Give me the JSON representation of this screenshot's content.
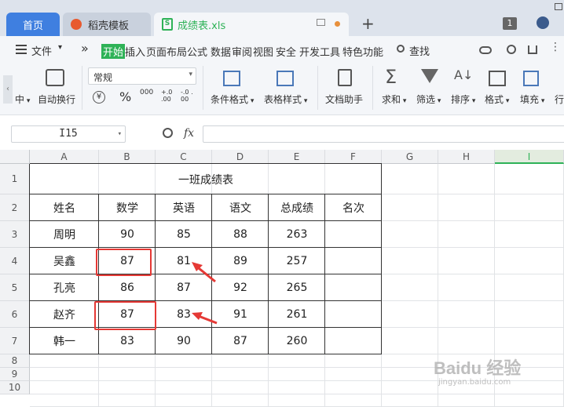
{
  "tabs": {
    "home": "首页",
    "template": "稻壳模板",
    "file": "成绩表.xls",
    "add": "+"
  },
  "titlebar": {
    "badge": "1"
  },
  "menu": {
    "file": "文件",
    "more": "»",
    "items": [
      "开始",
      "插入",
      "页面布局",
      "公式",
      "数据",
      "审阅",
      "视图",
      "安全",
      "开发工具",
      "特色功能"
    ],
    "search": "查找"
  },
  "ribbon": {
    "center": "中",
    "wrap": "自动换行",
    "format_value": "常规",
    "currency": "¥",
    "percent": "%",
    "thousands": "000",
    "inc_decimal": "+.0 .00",
    "dec_decimal": "-.0 .00",
    "cond_format": "条件格式",
    "table_style": "表格样式",
    "doc_helper": "文档助手",
    "sum": "求和",
    "filter": "筛选",
    "sort": "排序",
    "format": "格式",
    "fill": "填充",
    "row": "行"
  },
  "formula": {
    "namebox": "I15",
    "fx": "fx"
  },
  "columns": [
    "A",
    "B",
    "C",
    "D",
    "E",
    "F",
    "G",
    "H",
    "I"
  ],
  "rows": [
    "1",
    "2",
    "3",
    "4",
    "5",
    "6",
    "7",
    "8",
    "9",
    "10"
  ],
  "sheet": {
    "title": "一班成绩表",
    "headers": [
      "姓名",
      "数学",
      "英语",
      "语文",
      "总成绩",
      "名次"
    ],
    "data": [
      [
        "周明",
        "90",
        "85",
        "88",
        "263",
        ""
      ],
      [
        "吴鑫",
        "87",
        "81",
        "89",
        "257",
        ""
      ],
      [
        "孔亮",
        "86",
        "87",
        "92",
        "265",
        ""
      ],
      [
        "赵齐",
        "87",
        "83",
        "91",
        "261",
        ""
      ],
      [
        "韩一",
        "83",
        "90",
        "87",
        "260",
        ""
      ]
    ]
  },
  "watermark": {
    "main": "Baidu 经验",
    "sub": "jingyan.baidu.com"
  },
  "colors": {
    "accent_blue": "#3f7fe0",
    "ribbon_green": "#2eb257",
    "annotation_red": "#e53935"
  }
}
